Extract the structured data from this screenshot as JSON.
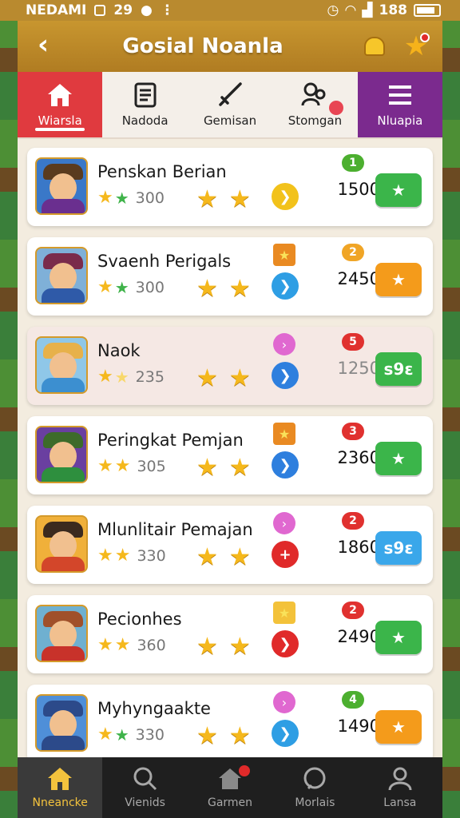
{
  "status_bar": {
    "carrier": "NEDAMI",
    "time": "29",
    "battery": "188"
  },
  "header": {
    "title": "Gosial Noanla"
  },
  "tabs": [
    {
      "label": "Wiarsla",
      "icon": "home-icon"
    },
    {
      "label": "Nadoda",
      "icon": "document-icon"
    },
    {
      "label": "Gemisan",
      "icon": "sword-icon"
    },
    {
      "label": "Stomgan",
      "icon": "people-icon"
    },
    {
      "label": "Nluapia",
      "icon": "menu-icon"
    }
  ],
  "players": [
    {
      "name": "Penskan Berian",
      "rating": "300",
      "rank": "1",
      "rank_color": "#4caf2f",
      "top_badge": "",
      "circle_color": "#f2c21b",
      "circle_glyph": "❯",
      "score": "1500",
      "action_label": "★",
      "action_color": "#3bb54a"
    },
    {
      "name": "Svaenh Perigals",
      "rating": "300",
      "rank": "2",
      "rank_color": "#f0a526",
      "top_badge": "star",
      "circle_color": "#2e9ee4",
      "circle_glyph": "❯",
      "score": "2450",
      "action_label": "★",
      "action_color": "#f49b1b"
    },
    {
      "name": "Naok",
      "rating": "235",
      "rank": "5",
      "rank_color": "#e0312f",
      "top_badge": "pink",
      "circle_color": "#2e7fde",
      "circle_glyph": "❯",
      "score": "1250",
      "action_label": "s9ɛ",
      "action_color": "#3bb54a"
    },
    {
      "name": "Peringkat Pemjan",
      "rating": "305",
      "rank": "3",
      "rank_color": "#e0312f",
      "top_badge": "star",
      "circle_color": "#2e7fde",
      "circle_glyph": "❯",
      "score": "2360",
      "action_label": "★",
      "action_color": "#3bb54a"
    },
    {
      "name": "Mlunlitair Pemajan",
      "rating": "330",
      "rank": "2",
      "rank_color": "#e0312f",
      "top_badge": "pink",
      "circle_color": "#e02a2a",
      "circle_glyph": "+",
      "score": "1860",
      "action_label": "s9ɛ",
      "action_color": "#3aa7ea"
    },
    {
      "name": "Pecionhes",
      "rating": "360",
      "rank": "2",
      "rank_color": "#e0312f",
      "top_badge": "star",
      "circle_color": "#e02a2a",
      "circle_glyph": "❯",
      "score": "2490",
      "action_label": "★",
      "action_color": "#3bb54a"
    },
    {
      "name": "Myhyngaakte",
      "rating": "330",
      "rank": "4",
      "rank_color": "#4caf2f",
      "top_badge": "pink",
      "circle_color": "#2e9ee4",
      "circle_glyph": "❯",
      "score": "1490",
      "action_label": "★",
      "action_color": "#f49b1b"
    }
  ],
  "bottom_nav": [
    {
      "label": "Nneancke",
      "icon": "home-icon"
    },
    {
      "label": "Vienids",
      "icon": "search-icon"
    },
    {
      "label": "Garmen",
      "icon": "house-icon"
    },
    {
      "label": "Morlais",
      "icon": "chat-icon"
    },
    {
      "label": "Lansa",
      "icon": "profile-icon"
    }
  ]
}
